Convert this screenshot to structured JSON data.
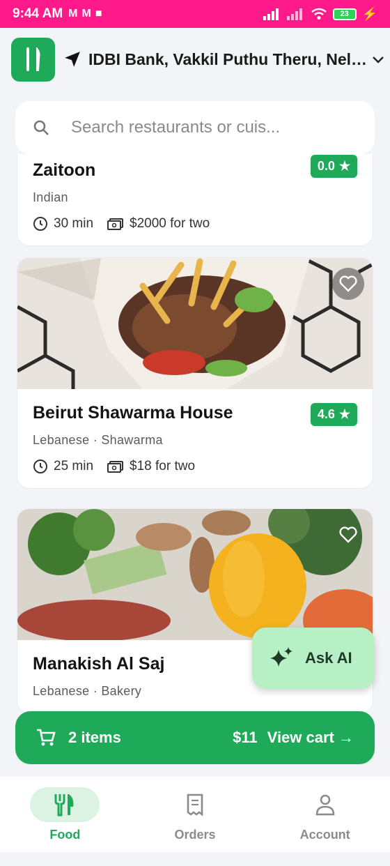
{
  "status_bar": {
    "time": "9:44 AM",
    "battery": "23"
  },
  "header": {
    "location": "IDBI Bank, Vakkil Puthu Theru, Nelpettai, Madurai"
  },
  "search": {
    "placeholder": "Search restaurants or cuis..."
  },
  "restaurants": [
    {
      "name": "Zaitoon",
      "cuisine": "Indian",
      "time": "30 min",
      "price": "$2000 for two",
      "rating": "0.0"
    },
    {
      "name": "Beirut Shawarma House",
      "cuisine": "Lebanese · Shawarma",
      "time": "25 min",
      "price": "$18 for two",
      "rating": "4.6"
    },
    {
      "name": "Manakish Al Saj",
      "cuisine": "Lebanese · Bakery"
    }
  ],
  "ask_ai": {
    "label": "Ask AI"
  },
  "cart": {
    "items": "2 items",
    "total": "$11",
    "cta": "View cart →"
  },
  "nav": {
    "food": "Food",
    "orders": "Orders",
    "account": "Account"
  },
  "colors": {
    "status_bar": "#ff1a8c",
    "brand_green": "#1faa59",
    "ask_ai_bg": "#b7f0c5"
  }
}
